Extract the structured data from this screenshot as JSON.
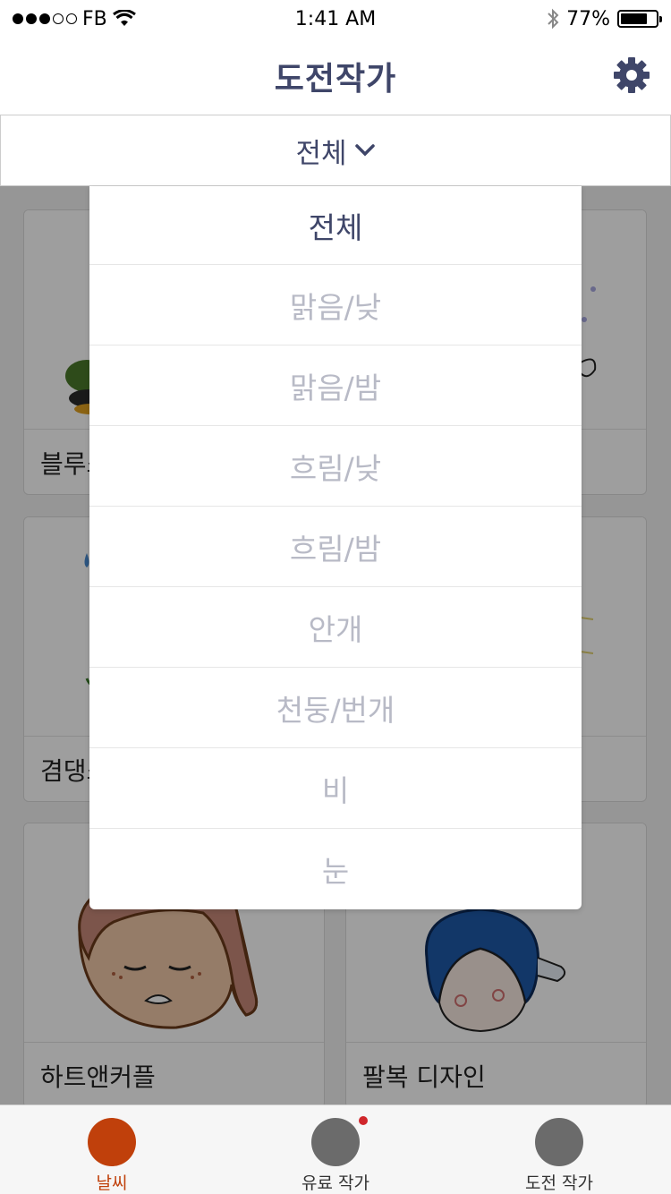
{
  "status_bar": {
    "carrier": "FB",
    "time": "1:41 AM",
    "battery_percent": "77%",
    "battery_level": 0.77
  },
  "header": {
    "title": "도전작가",
    "settings_icon": "gear-icon"
  },
  "filter": {
    "selected": "전체",
    "chevron_icon": "chevron-down-icon"
  },
  "dropdown": {
    "options": [
      "전체",
      "맑음/낮",
      "맑음/밤",
      "흐림/낮",
      "흐림/밤",
      "안개",
      "천둥/번개",
      "비",
      "눈"
    ],
    "selected_index": 0
  },
  "cards": [
    {
      "title": "블루소"
    },
    {
      "title": ""
    },
    {
      "title": "겸댕소"
    },
    {
      "title": ""
    },
    {
      "title": "하트앤커플"
    },
    {
      "title": "팔복 디자인"
    }
  ],
  "tab_bar": {
    "tabs": [
      {
        "label": "날씨",
        "active": true
      },
      {
        "label": "유료 작가",
        "active": false,
        "badge": true
      },
      {
        "label": "도전 작가",
        "active": false
      }
    ]
  },
  "colors": {
    "accent": "#c0400b",
    "header_text": "#3f4669",
    "inactive_option": "#b8bac6",
    "badge": "#d0262b"
  }
}
